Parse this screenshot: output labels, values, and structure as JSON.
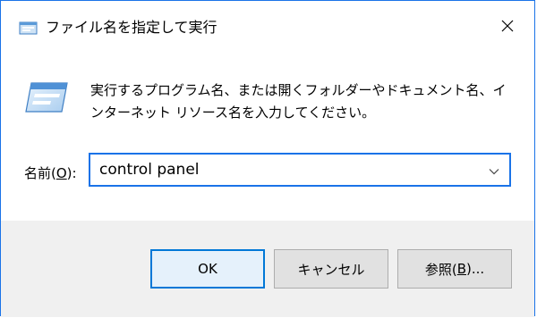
{
  "window": {
    "title": "ファイル名を指定して実行"
  },
  "body": {
    "description": "実行するプログラム名、または開くフォルダーやドキュメント名、インターネット リソース名を入力してください。",
    "name_label_prefix": "名前(",
    "name_label_accel": "O",
    "name_label_suffix": "):",
    "command_value": "control panel"
  },
  "buttons": {
    "ok": "OK",
    "cancel": "キャンセル",
    "browse_prefix": "参照(",
    "browse_accel": "B",
    "browse_suffix": ")..."
  },
  "icons": {
    "title": "run-icon",
    "close": "close-icon",
    "body": "run-icon",
    "dropdown": "chevron-down-icon"
  },
  "colors": {
    "accent": "#1a73e8",
    "ok_border": "#0078d7",
    "footer_bg": "#f0f0f0"
  }
}
